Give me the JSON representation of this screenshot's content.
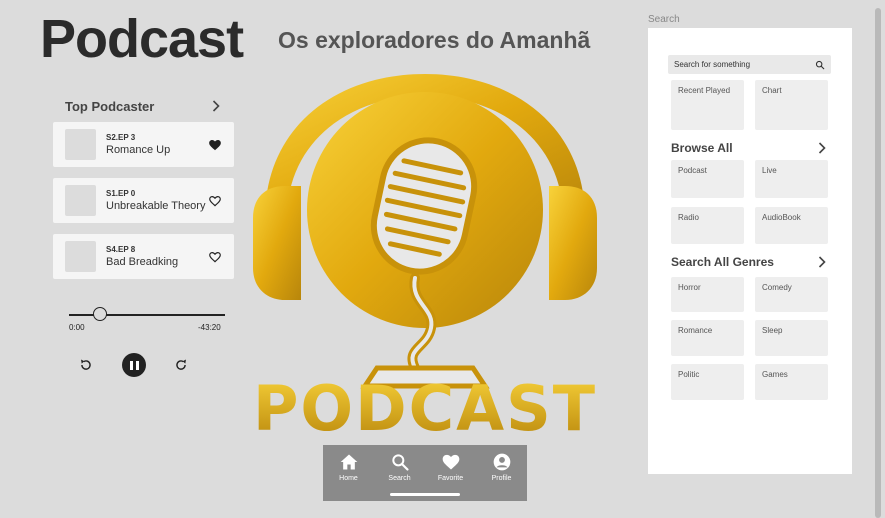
{
  "header": {
    "title": "Podcast",
    "subtitle": "Os exploradores do Amanhã"
  },
  "top_podcaster": {
    "heading": "Top Podcaster",
    "items": [
      {
        "code": "S2.EP 3",
        "title": "Romance Up",
        "favorited": true
      },
      {
        "code": "S1.EP 0",
        "title": "Unbreakable Theory",
        "favorited": false
      },
      {
        "code": "S4.EP 8",
        "title": "Bad Breadking",
        "favorited": false
      }
    ]
  },
  "player": {
    "time_elapsed": "0:00",
    "time_remaining": "-43:20",
    "progress": 0.2,
    "icons": {
      "rewind": "rewind-icon",
      "pause": "pause-icon",
      "forward": "forward-icon"
    }
  },
  "logo": {
    "text": "PODCAST",
    "colors": {
      "gold_light": "#f8d23a",
      "gold_mid": "#e2a90e",
      "gold_dark": "#b8860b"
    }
  },
  "bottom_nav": {
    "items": [
      {
        "label": "Home",
        "icon": "home-icon"
      },
      {
        "label": "Search",
        "icon": "search-icon"
      },
      {
        "label": "Favorite",
        "icon": "heart-icon"
      },
      {
        "label": "Profile",
        "icon": "profile-icon"
      }
    ],
    "active": "Search"
  },
  "search_panel": {
    "caption": "Search",
    "search_placeholder": "Search for something",
    "quick_tiles": [
      "Recent Played",
      "Chart"
    ],
    "browse_all": {
      "heading": "Browse All",
      "tiles": [
        "Podcast",
        "Live",
        "Radio",
        "AudioBook"
      ]
    },
    "genres": {
      "heading": "Search All Genres",
      "tiles": [
        "Horror",
        "Comedy",
        "Romance",
        "Sleep",
        "Politic",
        "Games"
      ]
    }
  }
}
